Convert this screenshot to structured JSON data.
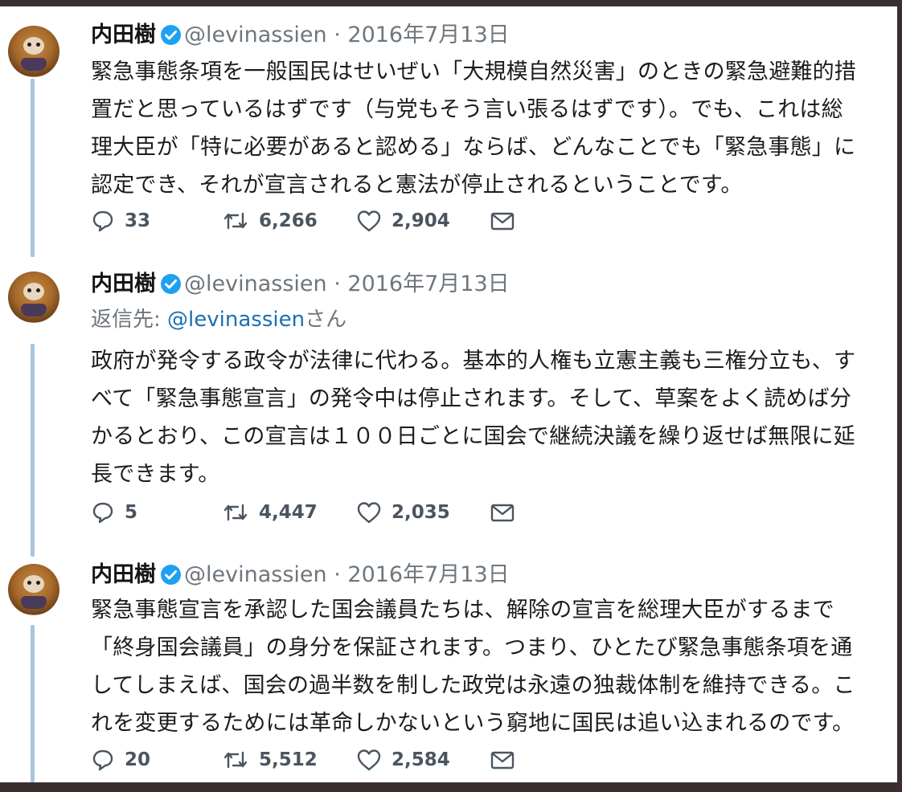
{
  "tweets": [
    {
      "name": "内田樹",
      "handle": "@levinassien",
      "separator": "·",
      "date": "2016年7月13日",
      "reply_prefix": "",
      "reply_mention": "",
      "reply_suffix": "",
      "body_lines": [
        "緊急事態条項を一般国民はせいぜい「大規模自然災害」のときの緊急避難的措",
        "置だと思っているはずです（与党もそう言い張るはずです）。でも、これは総",
        "理大臣が「特に必要があると認める」ならば、どんなことでも「緊急事態」に",
        "認定でき、それが宣言されると憲法が停止されるということです。"
      ],
      "replies": "33",
      "retweets": "6,266",
      "likes": "2,904"
    },
    {
      "name": "内田樹",
      "handle": "@levinassien",
      "separator": "·",
      "date": "2016年7月13日",
      "reply_prefix": "返信先: ",
      "reply_mention": "@levinassien",
      "reply_suffix": "さん",
      "body_lines": [
        "政府が発令する政令が法律に代わる。基本的人権も立憲主義も三権分立も、す",
        "べて「緊急事態宣言」の発令中は停止されます。そして、草案をよく読めば分",
        "かるとおり、この宣言は１００日ごとに国会で継続決議を繰り返せば無限に延",
        "長できます。"
      ],
      "replies": "5",
      "retweets": "4,447",
      "likes": "2,035"
    },
    {
      "name": "内田樹",
      "handle": "@levinassien",
      "separator": "·",
      "date": "2016年7月13日",
      "reply_prefix": "",
      "reply_mention": "",
      "reply_suffix": "",
      "body_lines": [
        "緊急事態宣言を承認した国会議員たちは、解除の宣言を総理大臣がするまで",
        "「終身国会議員」の身分を保証されます。つまり、ひとたび緊急事態条項を通",
        "してしまえば、国会の過半数を制した政党は永遠の独裁体制を維持できる。こ",
        "れを変更するためには革命しかないという窮地に国民は追い込まれるのです。"
      ],
      "replies": "20",
      "retweets": "5,512",
      "likes": "2,584"
    }
  ],
  "icons": {
    "reply": "reply-icon",
    "retweet": "retweet-icon",
    "like": "heart-icon",
    "dm": "envelope-icon",
    "verified": "verified-badge-icon",
    "accent": "#1da1f2"
  }
}
